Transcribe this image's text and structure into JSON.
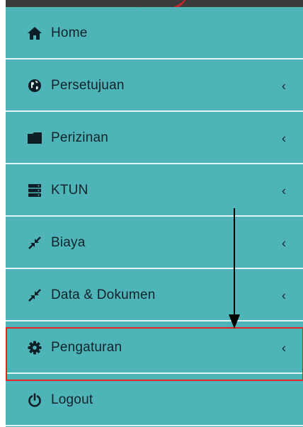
{
  "colors": {
    "sidebar_bg": "#4fb4b8",
    "separator": "#dff4f4",
    "text": "#11232a",
    "highlight_border": "#e32222",
    "annotation_arrow": "#000000"
  },
  "menu": {
    "items": [
      {
        "label": "Home",
        "icon": "home-icon",
        "has_submenu": false
      },
      {
        "label": "Persetujuan",
        "icon": "globe-icon",
        "has_submenu": true,
        "chevron": "‹"
      },
      {
        "label": "Perizinan",
        "icon": "folder-icon",
        "has_submenu": true,
        "chevron": "‹"
      },
      {
        "label": "KTUN",
        "icon": "server-icon",
        "has_submenu": true,
        "chevron": "‹"
      },
      {
        "label": "Biaya",
        "icon": "compress-icon",
        "has_submenu": true,
        "chevron": "‹"
      },
      {
        "label": "Data & Dokumen",
        "icon": "compress-icon",
        "has_submenu": true,
        "chevron": "‹"
      },
      {
        "label": "Pengaturan",
        "icon": "gear-icon",
        "has_submenu": true,
        "chevron": "‹",
        "highlighted": true
      },
      {
        "label": "Logout",
        "icon": "power-icon",
        "has_submenu": false
      }
    ]
  }
}
